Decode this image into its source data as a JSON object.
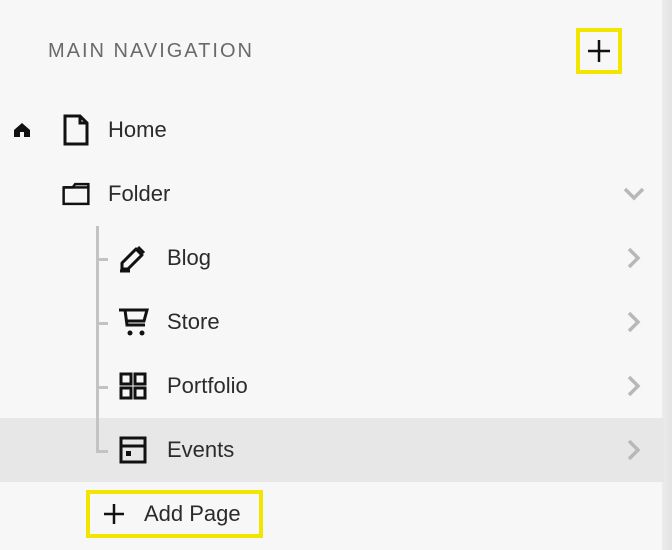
{
  "header": {
    "title": "MAIN NAVIGATION"
  },
  "nav": {
    "home_label": "Home",
    "folder_label": "Folder",
    "children": {
      "blog": "Blog",
      "store": "Store",
      "portfolio": "Portfolio",
      "events": "Events"
    },
    "add_page_label": "Add Page"
  },
  "colors": {
    "highlight": "#f2e600",
    "muted": "#6a6a6a",
    "chevron": "#b8b8b8",
    "selected_bg": "#e7e7e7"
  }
}
